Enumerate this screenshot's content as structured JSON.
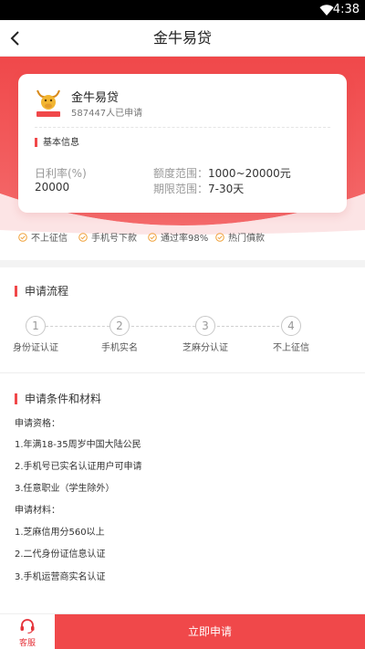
{
  "status": {
    "time": "4:38"
  },
  "nav": {
    "title": "金牛易贷",
    "back_icon": "chevron-left-icon"
  },
  "colors": {
    "brand": "#f0484a",
    "brand_light": "#f8c5c6",
    "text": "#333333",
    "muted": "#999999",
    "check": "#f0a23c"
  },
  "product": {
    "name": "金牛易贷",
    "logo_text": "金牛易贷",
    "applied_count": "587447人已申请",
    "basic_title": "基本信息",
    "rate_label": "日利率(%)",
    "rate_value": "20000",
    "amount_label": "额度范围：",
    "amount_value": "1000~20000元",
    "term_label": "期限范围：",
    "term_value": "7-30天"
  },
  "features": [
    "不上征信",
    "手机号下款",
    "通过率98%",
    "热门僨款"
  ],
  "process": {
    "title": "申请流程",
    "steps": [
      {
        "num": "1",
        "label": "身份证认证"
      },
      {
        "num": "2",
        "label": "手机实名"
      },
      {
        "num": "3",
        "label": "芝麻分认证"
      },
      {
        "num": "4",
        "label": "不上征信"
      }
    ]
  },
  "conditions": {
    "title": "申请条件和材料",
    "qualification_title": "申请资格：",
    "qualifications": [
      "1.年满18-35周岁中国大陆公民",
      "2.手机号已实名认证用户可申请",
      "3.任意职业（学生除外）"
    ],
    "materials_title": "申请材料：",
    "materials": [
      "1.芝麻信用分560以上",
      "2.二代身份证信息认证",
      "3.手机运营商实名认证"
    ]
  },
  "bottom": {
    "service_label": "客服",
    "apply_label": "立即申请"
  }
}
